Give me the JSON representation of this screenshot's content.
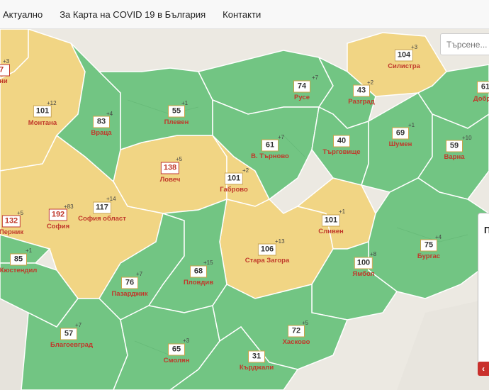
{
  "nav": {
    "items": [
      "Актуално",
      "За Карта на COVID 19 в България",
      "Контакти"
    ]
  },
  "search": {
    "placeholder": "Търсене..."
  },
  "side_panel": {
    "title": "П"
  },
  "colors": {
    "green": "#72c583",
    "yellow": "#f1d584",
    "border": "#ffffff",
    "alert": "#c0392b"
  },
  "provinces": [
    {
      "name": "ини",
      "count": "7",
      "delta": "+3"
    },
    {
      "name": "Монтана",
      "count": "101",
      "delta": "+12"
    },
    {
      "name": "Враца",
      "count": "83",
      "delta": "+4"
    },
    {
      "name": "Плевен",
      "count": "55",
      "delta": "+1"
    },
    {
      "name": "Русе",
      "count": "74",
      "delta": "+7"
    },
    {
      "name": "Разград",
      "count": "43",
      "delta": "+2"
    },
    {
      "name": "Силистра",
      "count": "104",
      "delta": "+3"
    },
    {
      "name": "Добр",
      "count": "61",
      "delta": ""
    },
    {
      "name": "Ловеч",
      "count": "138",
      "delta": "+5"
    },
    {
      "name": "В. Търново",
      "count": "61",
      "delta": "+7"
    },
    {
      "name": "Търговище",
      "count": "40",
      "delta": ""
    },
    {
      "name": "Шумен",
      "count": "69",
      "delta": "+1"
    },
    {
      "name": "Варна",
      "count": "59",
      "delta": "+10"
    },
    {
      "name": "Габрово",
      "count": "101",
      "delta": "+2"
    },
    {
      "name": "София",
      "count": "192",
      "delta": "+83"
    },
    {
      "name": "София област",
      "count": "117",
      "delta": "+14"
    },
    {
      "name": "Перник",
      "count": "132",
      "delta": "+5"
    },
    {
      "name": "Кюстендил",
      "count": "85",
      "delta": "+1"
    },
    {
      "name": "Сливен",
      "count": "101",
      "delta": "+1"
    },
    {
      "name": "Стара Загора",
      "count": "106",
      "delta": "+13"
    },
    {
      "name": "Ямбол",
      "count": "100",
      "delta": "+8"
    },
    {
      "name": "Бургас",
      "count": "75",
      "delta": "+4"
    },
    {
      "name": "Пазарджик",
      "count": "76",
      "delta": "+7"
    },
    {
      "name": "Пловдив",
      "count": "68",
      "delta": "+15"
    },
    {
      "name": "Благоевград",
      "count": "57",
      "delta": "+7"
    },
    {
      "name": "Хасково",
      "count": "72",
      "delta": "+5"
    },
    {
      "name": "Смолян",
      "count": "65",
      "delta": "+3"
    },
    {
      "name": "Кърджали",
      "count": "31",
      "delta": ""
    }
  ]
}
